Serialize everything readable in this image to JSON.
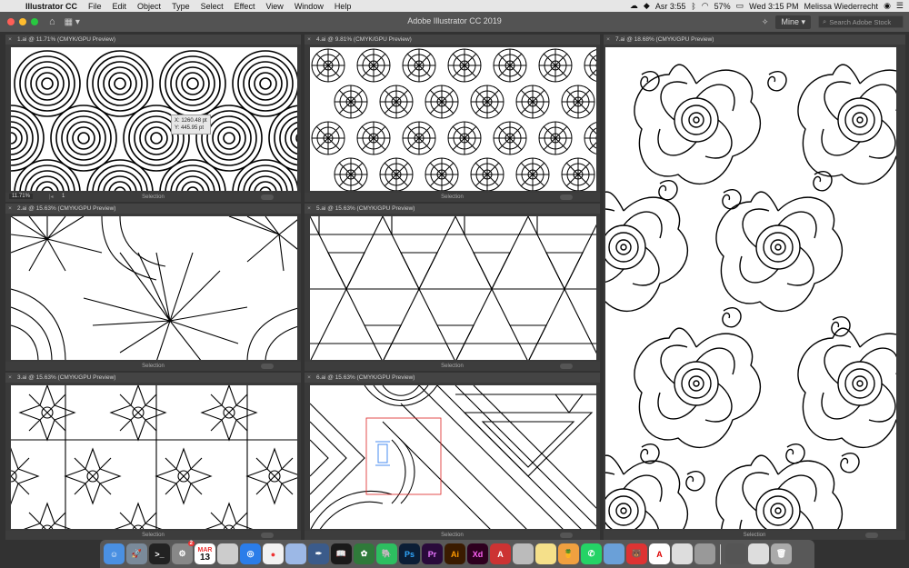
{
  "menubar": {
    "app_name": "Illustrator CC",
    "items": [
      "File",
      "Edit",
      "Object",
      "Type",
      "Select",
      "Effect",
      "View",
      "Window",
      "Help"
    ],
    "prayer": "Asr 3:55",
    "battery": "57%",
    "clock": "Wed 3:15 PM",
    "user": "Melissa Wiederrecht"
  },
  "appbar": {
    "title": "Adobe Illustrator CC 2019",
    "libraries": "Mine",
    "stock_placeholder": "Search Adobe Stock"
  },
  "documents": [
    {
      "tab": "1.ai @ 11.71% (CMYK/GPU Preview)",
      "status_tool": "Selection",
      "zoom": "11.71%",
      "page": "1"
    },
    {
      "tab": "4.ai @ 9.81% (CMYK/GPU Preview)",
      "status_tool": "Selection"
    },
    {
      "tab": "7.ai @ 18.68% (CMYK/GPU Preview)",
      "status_tool": "Selection"
    },
    {
      "tab": "2.ai @ 15.63% (CMYK/GPU Preview)",
      "status_tool": "Selection"
    },
    {
      "tab": "5.ai @ 15.63% (CMYK/GPU Preview)",
      "status_tool": "Selection"
    },
    {
      "tab": "3.ai @ 15.63% (CMYK/GPU Preview)",
      "status_tool": "Selection"
    },
    {
      "tab": "6.ai @ 15.63% (CMYK/GPU Preview)",
      "status_tool": "Selection"
    }
  ],
  "cursor_tooltip": {
    "x": "X: 1260.48 pt",
    "y": "Y: 445.95 pt"
  },
  "dock": {
    "calendar_month": "MAR",
    "calendar_day": "13",
    "prefs_badge": "2",
    "apps": [
      "Finder",
      "Launchpad",
      "Terminal",
      "System Preferences",
      "Calendar",
      "Notes",
      "Safari",
      "Chrome",
      "Preview",
      "Quill",
      "Kindle",
      "Quran",
      "Evernote",
      "Photoshop",
      "Premiere",
      "Illustrator",
      "XD",
      "Dictionary",
      "Photo",
      "Stickies",
      "Fruit",
      "WhatsApp",
      "Preview2",
      "Bear",
      "Acrobat",
      "Papers",
      "Screenshot",
      "Folder",
      "Mail",
      "Trash"
    ],
    "labels": {
      "ps": "Ps",
      "pr": "Pr",
      "ai": "Ai",
      "xd": "Xd"
    }
  },
  "colors": {
    "ps": "#0b1e36",
    "pr": "#2a0a3b",
    "ai": "#3a1b00",
    "xd": "#2e001f"
  }
}
